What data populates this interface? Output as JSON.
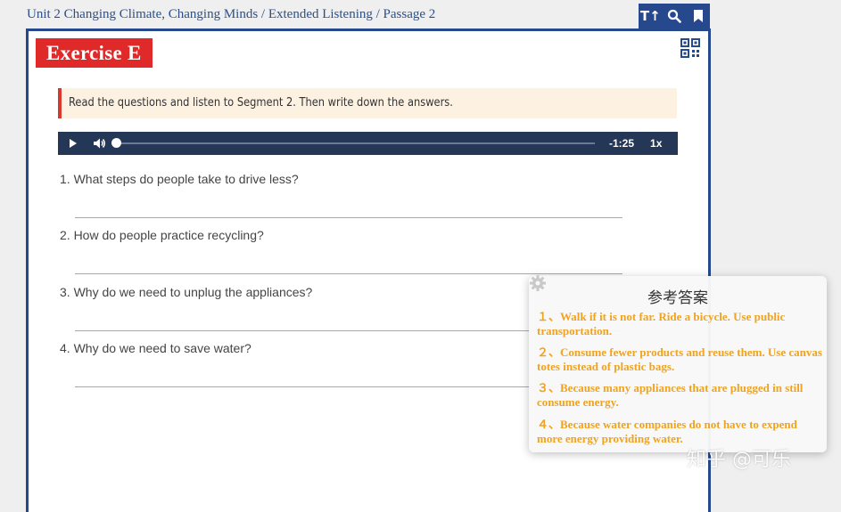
{
  "breadcrumb": "Unit 2 Changing Climate, Changing Minds / Extended Listening / Passage 2",
  "toolbar": {
    "text_size_label": "T↑",
    "icons": [
      "text-size-icon",
      "search-icon",
      "bookmark-icon"
    ]
  },
  "exercise": {
    "title": "Exercise E",
    "instruction": "Read the questions and listen to Segment 2. Then write down the answers."
  },
  "player": {
    "time": "-1:25",
    "speed": "1x",
    "progress": 0
  },
  "questions": [
    "1. What steps do people take to drive less?",
    "2. How do people practice recycling?",
    "3. Why do we need to unplug the appliances?",
    "4. Why do we need to save water?"
  ],
  "popup": {
    "title": "参考答案",
    "answers": [
      "１、Walk if it is not far. Ride a bicycle. Use public transportation.",
      "２、Consume fewer products and reuse them. Use canvas totes instead of plastic bags.",
      "３、Because many appliances that are plugged in still consume energy.",
      "４、Because water companies do not have to expend more energy providing water."
    ]
  },
  "watermark": "知乎 @可乐",
  "colors": {
    "brand_blue": "#26488c",
    "exercise_red": "#e02a2a",
    "answer_orange": "#f0a31e",
    "player_bg": "#253757"
  }
}
